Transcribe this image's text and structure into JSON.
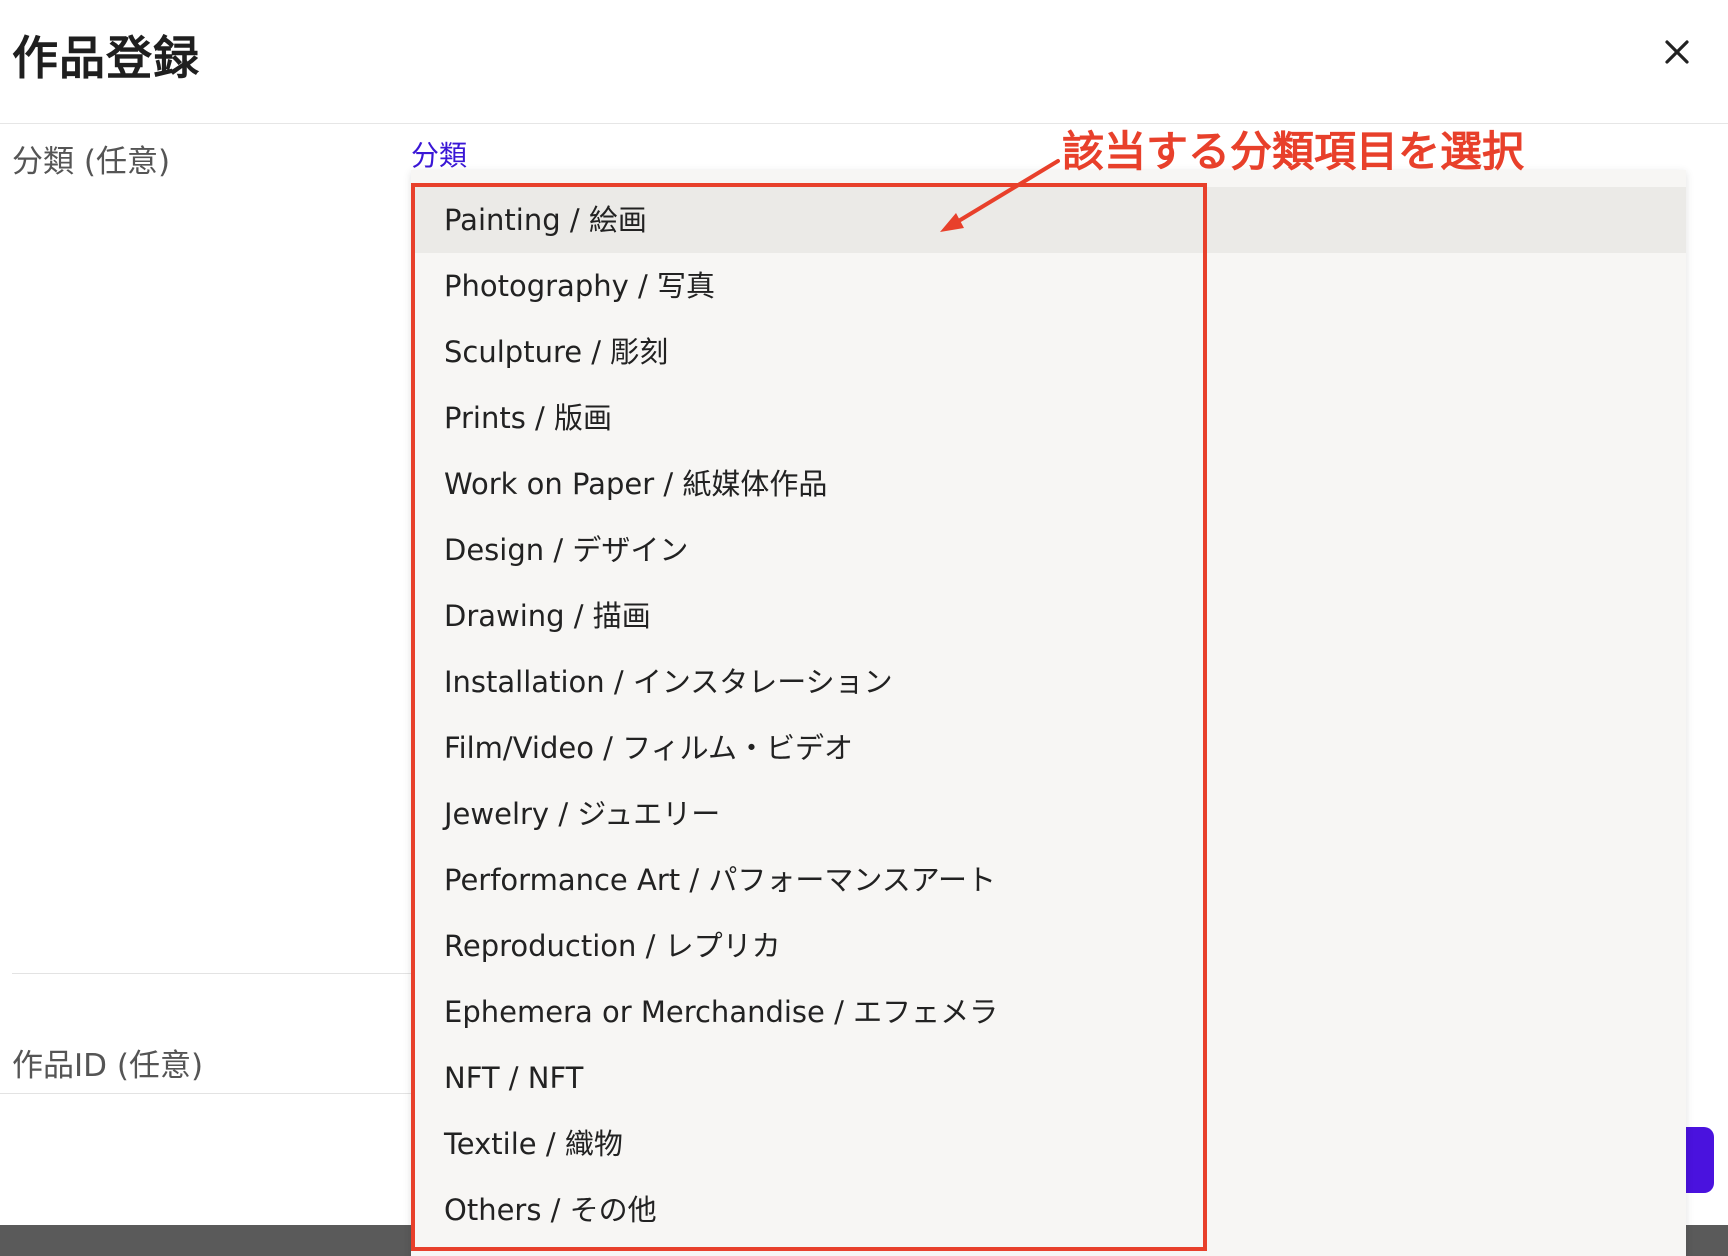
{
  "modal": {
    "title": "作品登録"
  },
  "form": {
    "category": {
      "label": "分類 (任意)",
      "select_text": "分類"
    },
    "artwork_id": {
      "label": "作品ID (任意)"
    }
  },
  "dropdown": {
    "hovered_option": "Painting / 絵画",
    "options": [
      "Painting / 絵画",
      "Photography / 写真",
      "Sculpture / 彫刻",
      "Prints / 版画",
      "Work on Paper / 紙媒体作品",
      "Design / デザイン",
      "Drawing / 描画",
      "Installation / インスタレーション",
      "Film/Video / フィルム・ビデオ",
      "Jewelry / ジュエリー",
      "Performance Art / パフォーマンスアート",
      "Reproduction / レプリカ",
      "Ephemera or Merchandise / エフェメラ",
      "NFT / NFT",
      "Textile / 織物",
      "Others / その他"
    ]
  },
  "annotation": {
    "text": "該当する分類項目を選択",
    "color": "#e8402b"
  },
  "colors": {
    "accent": "#3a17d6",
    "button": "#4a12de",
    "annotation": "#e8402b",
    "dropdown_bg": "#f7f6f4",
    "hover_bg": "#ebeae7"
  },
  "icons": {
    "close": "close-icon",
    "arrow": "annotation-arrow"
  }
}
